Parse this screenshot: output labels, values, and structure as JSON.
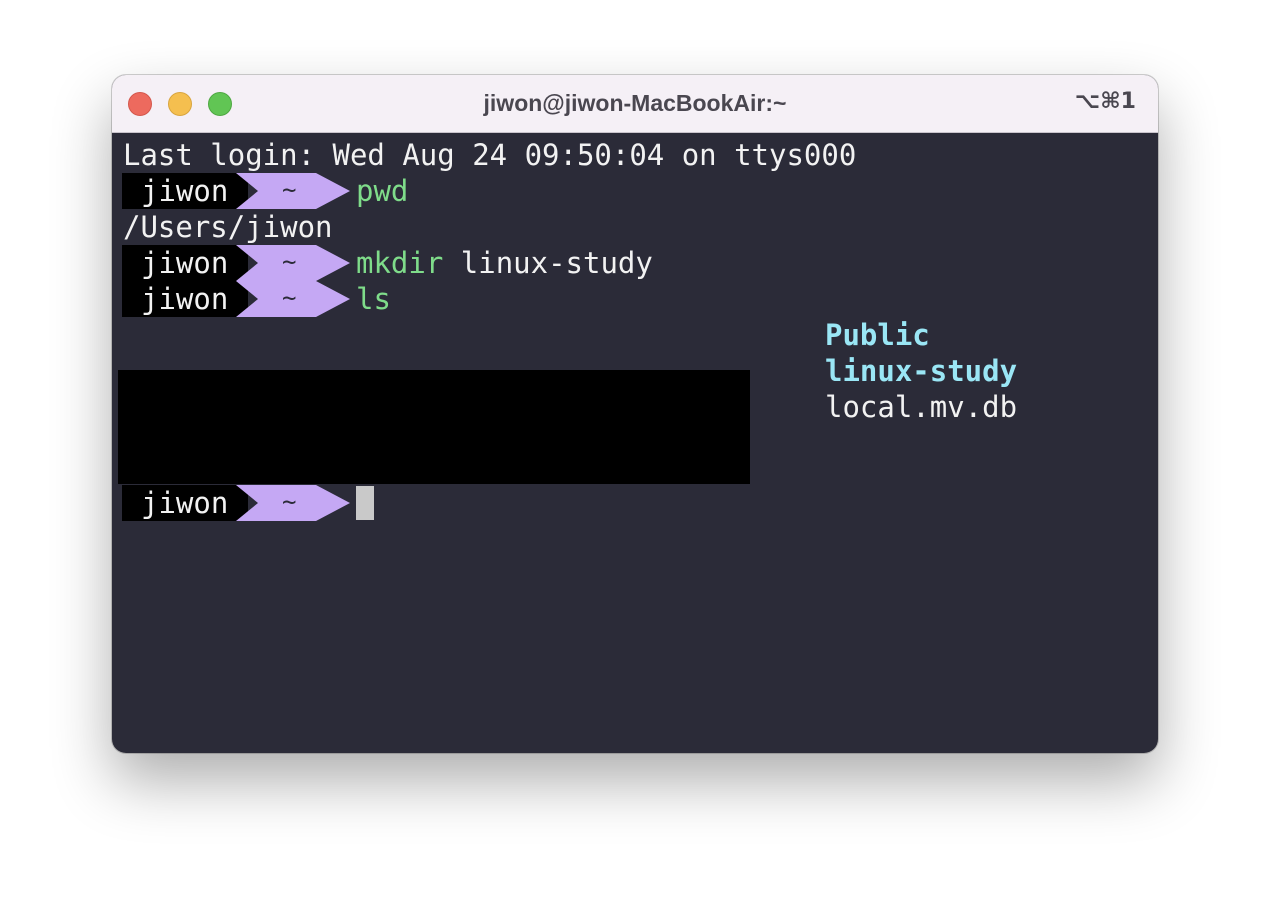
{
  "window": {
    "title": "jiwon@jiwon-MacBookAir:~",
    "shortcut": "⌥⌘1"
  },
  "terminal": {
    "last_login": "Last login: Wed Aug 24 09:50:04 on ttys000",
    "prompt_user": "jiwon",
    "prompt_dir": "~",
    "commands": [
      {
        "cmd": "pwd",
        "args": ""
      },
      {
        "cmd": "mkdir",
        "args": " linux-study"
      },
      {
        "cmd": "ls",
        "args": ""
      }
    ],
    "pwd_output": "/Users/jiwon",
    "ls_output": [
      {
        "name": "Public",
        "type": "directory"
      },
      {
        "name": "linux-study",
        "type": "directory"
      },
      {
        "name": "local.mv.db",
        "type": "file"
      }
    ]
  },
  "colors": {
    "background": "#2b2b38",
    "prompt_segment": "#c5a8f4",
    "command": "#7fdc8a",
    "directory": "#9ae6f5"
  }
}
